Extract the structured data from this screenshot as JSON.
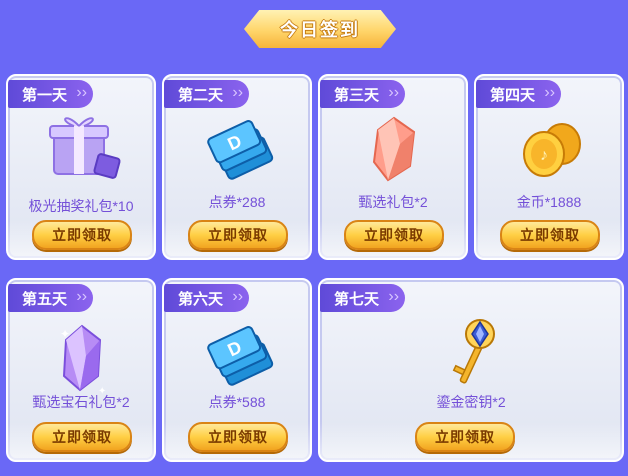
{
  "header": {
    "title": "今日签到"
  },
  "claim_label": "立即领取",
  "days": [
    {
      "day": "第一天",
      "reward": "极光抽奖礼包*10",
      "icon": "purple-gift-box-icon"
    },
    {
      "day": "第二天",
      "reward": "点券*288",
      "icon": "blue-coupon-stack-icon"
    },
    {
      "day": "第三天",
      "reward": "甄选礼包*2",
      "icon": "orange-crystal-icon"
    },
    {
      "day": "第四天",
      "reward": "金币*1888",
      "icon": "gold-coins-icon"
    },
    {
      "day": "第五天",
      "reward": "甄选宝石礼包*2",
      "icon": "purple-gem-icon"
    },
    {
      "day": "第六天",
      "reward": "点券*588",
      "icon": "blue-coupon-stack-icon"
    },
    {
      "day": "第七天",
      "reward": "鎏金密钥*2",
      "icon": "golden-key-icon"
    }
  ],
  "colors": {
    "background": "#6a68f6",
    "tag": "#6a52e0",
    "reward_text": "#7450d8",
    "button": "#ffcf44"
  }
}
